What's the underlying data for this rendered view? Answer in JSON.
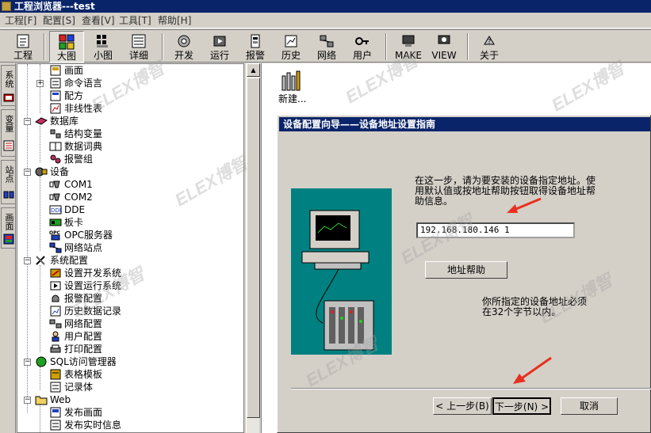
{
  "window": {
    "title": "工程浏览器---test"
  },
  "menu": [
    {
      "label": "工程[F]"
    },
    {
      "label": "配置[S]"
    },
    {
      "label": "查看[V]"
    },
    {
      "label": "工具[T]"
    },
    {
      "label": "帮助[H]"
    }
  ],
  "toolbar": [
    {
      "label": "工程",
      "icon": "project-icon"
    },
    {
      "label": "大图",
      "icon": "large-icons-icon",
      "pressed": true
    },
    {
      "label": "小图",
      "icon": "small-icons-icon"
    },
    {
      "label": "详细",
      "icon": "details-icon"
    },
    {
      "label": "开发",
      "icon": "develop-icon"
    },
    {
      "label": "运行",
      "icon": "run-icon"
    },
    {
      "label": "报警",
      "icon": "alarm-icon"
    },
    {
      "label": "历史",
      "icon": "history-icon"
    },
    {
      "label": "网络",
      "icon": "network-icon"
    },
    {
      "label": "用户",
      "icon": "user-icon"
    },
    {
      "label": "MAKE",
      "icon": "make-icon"
    },
    {
      "label": "VIEW",
      "icon": "view-icon"
    },
    {
      "label": "关于",
      "icon": "about-icon"
    }
  ],
  "left_tabs": [
    {
      "label": "系统"
    },
    {
      "label": "变量"
    },
    {
      "label": "站点"
    },
    {
      "label": "画面"
    }
  ],
  "tree": [
    {
      "label": "画面",
      "level": 2
    },
    {
      "label": "命令语言",
      "level": 2,
      "expander": "+"
    },
    {
      "label": "配方",
      "level": 2
    },
    {
      "label": "非线性表",
      "level": 2
    },
    {
      "label": "数据库",
      "level": 1,
      "expander": "-"
    },
    {
      "label": "结构变量",
      "level": 2
    },
    {
      "label": "数据词典",
      "level": 2
    },
    {
      "label": "报警组",
      "level": 2
    },
    {
      "label": "设备",
      "level": 1,
      "expander": "-"
    },
    {
      "label": "COM1",
      "level": 2
    },
    {
      "label": "COM2",
      "level": 2
    },
    {
      "label": "DDE",
      "level": 2
    },
    {
      "label": "板卡",
      "level": 2
    },
    {
      "label": "OPC服务器",
      "level": 2
    },
    {
      "label": "网络站点",
      "level": 2
    },
    {
      "label": "系统配置",
      "level": 1,
      "expander": "-"
    },
    {
      "label": "设置开发系统",
      "level": 2
    },
    {
      "label": "设置运行系统",
      "level": 2
    },
    {
      "label": "报警配置",
      "level": 2
    },
    {
      "label": "历史数据记录",
      "level": 2
    },
    {
      "label": "网络配置",
      "level": 2
    },
    {
      "label": "用户配置",
      "level": 2
    },
    {
      "label": "打印配置",
      "level": 2
    },
    {
      "label": "SQL访问管理器",
      "level": 1,
      "expander": "-"
    },
    {
      "label": "表格模板",
      "level": 2
    },
    {
      "label": "记录体",
      "level": 2
    },
    {
      "label": "Web",
      "level": 1,
      "expander": "-"
    },
    {
      "label": "发布画面",
      "level": 2
    },
    {
      "label": "发布实时信息",
      "level": 2
    }
  ],
  "right_pane": {
    "new_item_label": "新建..."
  },
  "dialog": {
    "title": "设备配置向导——设备地址设置指南",
    "description": "在这一步，请为要安装的设备指定地址。使用默认值或按地址帮助按钮取得设备地址帮助信息。",
    "address_value": "192.168.180.146 1",
    "address_help_button": "地址帮助",
    "hint": "你所指定的设备地址必须在32个字节以内。",
    "back_button": "< 上一步(B)",
    "next_button": "下一步(N) >",
    "cancel_button": "取消"
  },
  "watermark": {
    "text": "ELEX博智"
  },
  "colors": {
    "titlebar": "#0a246a",
    "illustration_bg": "#008080",
    "arrow": "#e83020"
  }
}
